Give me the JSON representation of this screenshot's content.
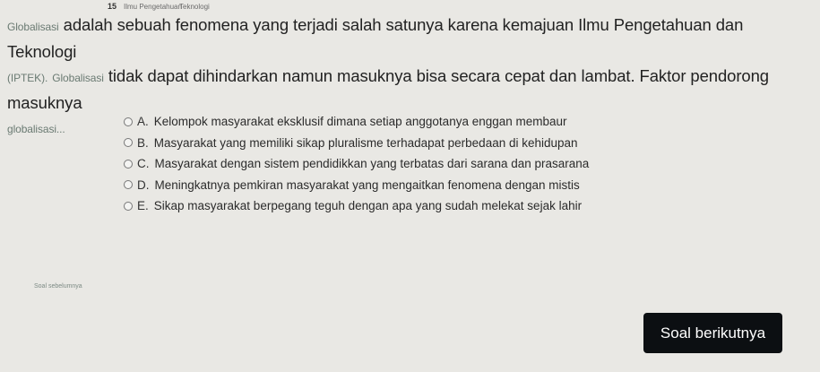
{
  "header": {
    "question_number": "15",
    "meta_left": "Ilmu Pengetahuan",
    "meta_right": "Teknologi"
  },
  "question": {
    "term": "Globalisasi",
    "text_part1": " adalah sebuah fenomena yang terjadi salah satunya karena kemajuan Ilmu Pengetahuan dan Teknologi",
    "abbr": "(IPTEK).",
    "term2": "Globalisasi",
    "text_part2": " tidak dapat dihindarkan namun masuknya bisa secara cepat dan lambat. Faktor pendorong masuknya",
    "tail": "globalisasi..."
  },
  "options": [
    {
      "letter": "A.",
      "text": "Kelompok masyarakat eksklusif dimana setiap anggotanya enggan membaur"
    },
    {
      "letter": "B.",
      "text": "Masyarakat yang memiliki sikap pluralisme terhadapat perbedaan di kehidupan"
    },
    {
      "letter": "C.",
      "text": "Masyarakat dengan sistem pendidikkan yang terbatas dari sarana dan prasarana"
    },
    {
      "letter": "D.",
      "text": "Meningkatnya pemkiran masyarakat yang mengaitkan fenomena dengan mistis"
    },
    {
      "letter": "E.",
      "text": "Sikap masyarakat berpegang teguh dengan apa yang sudah melekat sejak lahir"
    }
  ],
  "footer": {
    "label": "Soal sebelumnya"
  },
  "next_button": {
    "label": "Soal berikutnya"
  }
}
